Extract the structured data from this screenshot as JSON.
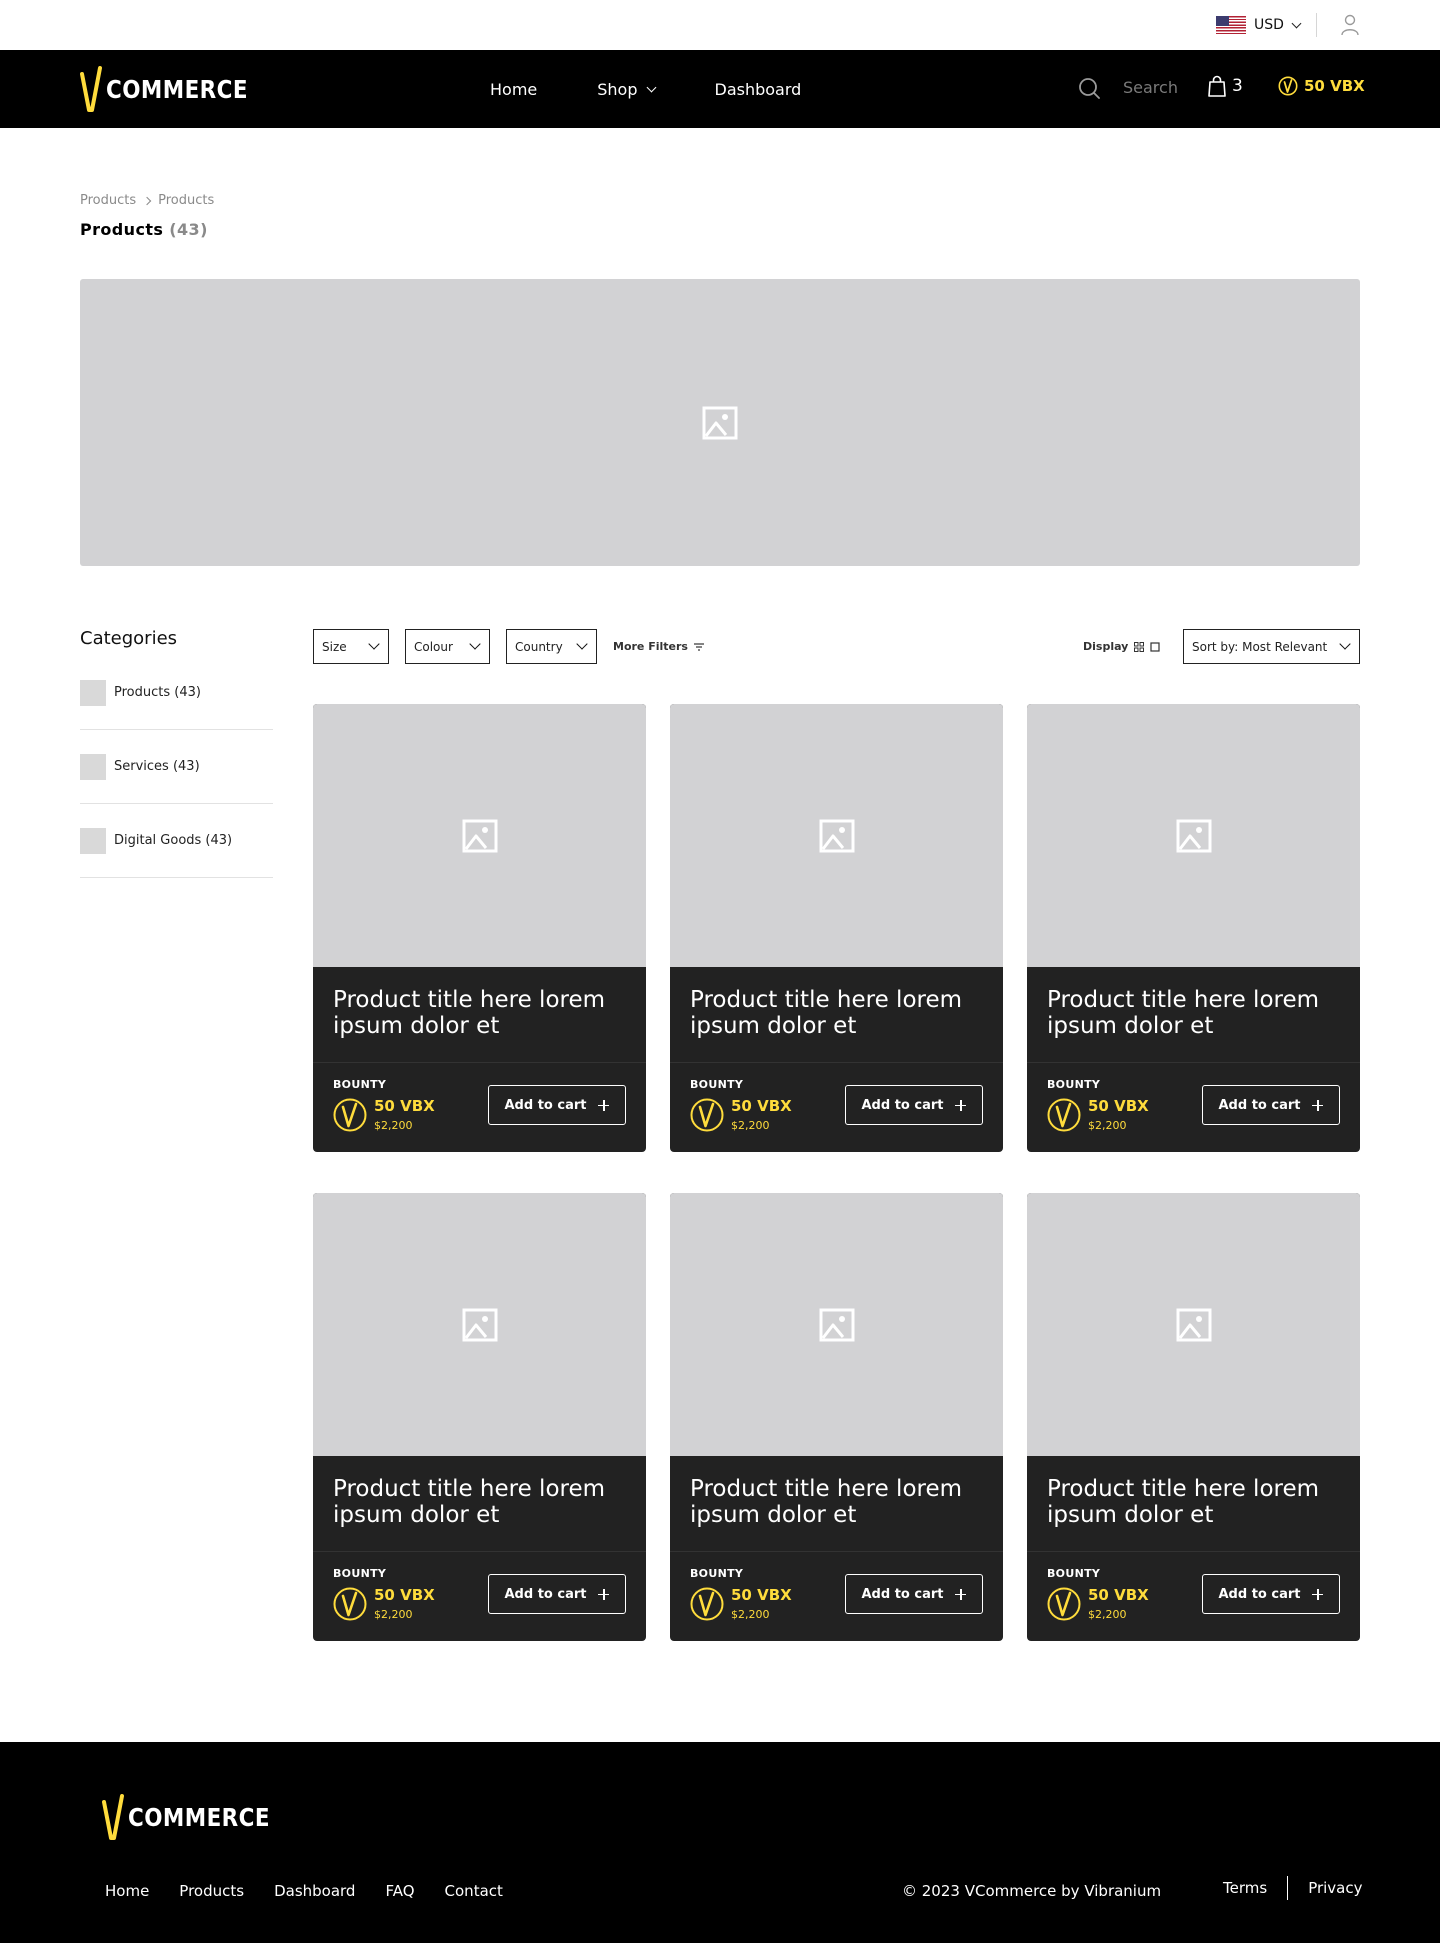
{
  "header": {
    "currency": "USD",
    "brand": "COMMERCE",
    "nav": [
      "Home",
      "Shop",
      "Dashboard"
    ],
    "search_placeholder": "Search",
    "cart_count": "3",
    "balance": "50 VBX"
  },
  "breadcrumb": [
    "Products",
    "Products"
  ],
  "page": {
    "title": "Products",
    "count": "(43)"
  },
  "categories": {
    "title": "Categories",
    "items": [
      "Products (43)",
      "Services (43)",
      "Digital Goods (43)"
    ]
  },
  "filters": {
    "size": "Size",
    "colour": "Colour",
    "country": "Country",
    "more": "More Filters",
    "display": "Display",
    "sort": "Sort by: Most Relevant"
  },
  "products": [
    {
      "title": "Product title here lorem ipsum dolor et",
      "bounty_label": "BOUNTY",
      "vbx": "50 VBX",
      "usd": "$2,200",
      "cta": "Add to cart"
    },
    {
      "title": "Product title here lorem ipsum dolor et",
      "bounty_label": "BOUNTY",
      "vbx": "50 VBX",
      "usd": "$2,200",
      "cta": "Add to cart"
    },
    {
      "title": "Product title here lorem ipsum dolor et",
      "bounty_label": "BOUNTY",
      "vbx": "50 VBX",
      "usd": "$2,200",
      "cta": "Add to cart"
    },
    {
      "title": "Product title here lorem ipsum dolor et",
      "bounty_label": "BOUNTY",
      "vbx": "50 VBX",
      "usd": "$2,200",
      "cta": "Add to cart"
    },
    {
      "title": "Product title here lorem ipsum dolor et",
      "bounty_label": "BOUNTY",
      "vbx": "50 VBX",
      "usd": "$2,200",
      "cta": "Add to cart"
    },
    {
      "title": "Product title here lorem ipsum dolor et",
      "bounty_label": "BOUNTY",
      "vbx": "50 VBX",
      "usd": "$2,200",
      "cta": "Add to cart"
    }
  ],
  "footer": {
    "brand": "COMMERCE",
    "links": [
      "Home",
      "Products",
      "Dashboard",
      "FAQ",
      "Contact"
    ],
    "copyright": "© 2023 VCommerce by Vibranium",
    "terms": "Terms",
    "privacy": "Privacy"
  },
  "colors": {
    "accent": "#ffdc3c",
    "nav_bg": "#000000",
    "card_bg": "#222222",
    "placeholder": "#d2d2d4"
  },
  "icons": [
    "us-flag-icon",
    "user-icon",
    "search-icon",
    "shopping-bag-icon",
    "vbx-coin-icon",
    "image-placeholder-icon",
    "chevron-down-icon",
    "filter-icon",
    "grid-view-icon",
    "list-view-icon",
    "plus-icon"
  ]
}
